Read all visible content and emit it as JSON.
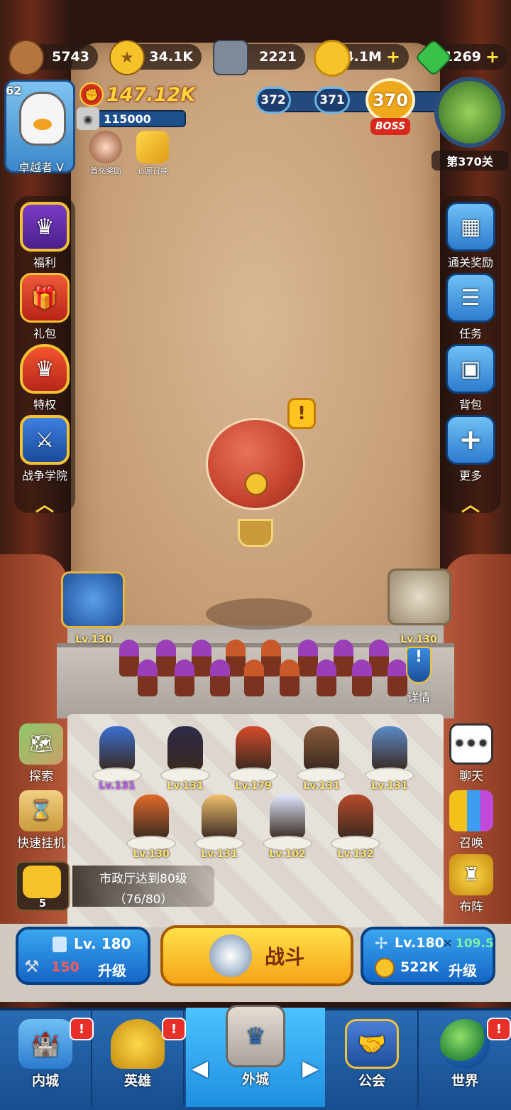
{
  "resources": [
    {
      "name": "wood",
      "value": "5743",
      "icon": "log-icon"
    },
    {
      "name": "gold-token",
      "value": "34.1K",
      "icon": "star-coin-icon"
    },
    {
      "name": "stone",
      "value": "2221",
      "icon": "stone-icon"
    },
    {
      "name": "coin",
      "value": "14.1M",
      "icon": "coin-icon",
      "plus": "+"
    },
    {
      "name": "gem",
      "value": "1269",
      "icon": "gem-icon",
      "plus": "+"
    }
  ],
  "player": {
    "level": "62",
    "name": "卓越者 V",
    "power": "147.12K",
    "exp": "115000"
  },
  "events": [
    {
      "label": "首充奖励"
    },
    {
      "label": "心愿召唤"
    }
  ],
  "stages": {
    "prev2": "372",
    "prev1": "371",
    "current": "370",
    "boss": "BOSS",
    "label": "第370关"
  },
  "left_menu": [
    {
      "label": "福利",
      "icon": "crown-badge-icon"
    },
    {
      "label": "礼包",
      "icon": "gift-icon"
    },
    {
      "label": "特权",
      "icon": "privilege-crown-icon"
    },
    {
      "label": "战争学院",
      "icon": "crossed-swords-icon"
    }
  ],
  "right_menu": [
    {
      "label": "通关奖励",
      "icon": "reward-box-icon"
    },
    {
      "label": "任务",
      "icon": "task-list-icon"
    },
    {
      "label": "背包",
      "icon": "backpack-icon"
    },
    {
      "label": "更多",
      "icon": "plus-icon"
    }
  ],
  "alert": "!",
  "towers": [
    {
      "label": "Lv.130"
    },
    {
      "label": "Lv.130"
    }
  ],
  "details_label": "详情",
  "heroes_row1": [
    "Lv.131",
    "Lv.131",
    "Lv.179",
    "Lv.131",
    "Lv.131"
  ],
  "heroes_row2": [
    "Lv.130",
    "Lv.131",
    "Lv.102",
    "Lv.132"
  ],
  "left_tools": [
    {
      "label": "探索",
      "icon": "map-icon"
    },
    {
      "label": "快速挂机",
      "icon": "hourglass-icon"
    }
  ],
  "right_tools": [
    {
      "label": "聊天",
      "icon": "chat-icon"
    },
    {
      "label": "召唤",
      "icon": "cards-icon"
    },
    {
      "label": "布阵",
      "icon": "formation-icon"
    }
  ],
  "quest": {
    "count": "5",
    "line1": "市政厅达到80级",
    "line2": "（76/80）"
  },
  "castle_upgrade": {
    "level": "Lv. 180",
    "cost": "150",
    "action": "升级"
  },
  "fight_label": "战斗",
  "army_upgrade": {
    "level": "Lv.180",
    "bonus": "109.5",
    "cost": "522K",
    "action": "升级"
  },
  "nav": [
    {
      "label": "内城",
      "icon": "castle-icon",
      "badge": "!"
    },
    {
      "label": "英雄",
      "icon": "helmet-icon",
      "badge": "!"
    },
    {
      "label": "外城",
      "icon": "tower-icon"
    },
    {
      "label": "公会",
      "icon": "handshake-icon"
    },
    {
      "label": "世界",
      "icon": "globe-icon",
      "badge": "!"
    }
  ],
  "colors": {
    "accent_yellow": "#ffd43a",
    "nav_blue": "#2a6bb3",
    "alert_red": "#e8302a",
    "hero_lv_purple": "#c55cff"
  }
}
